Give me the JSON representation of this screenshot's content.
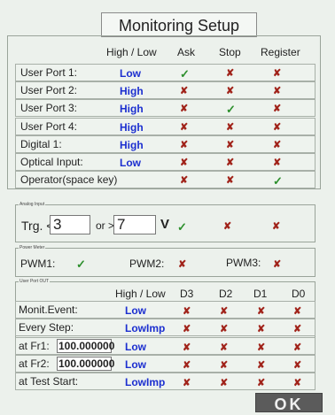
{
  "title": "Monitoring Setup",
  "monitor": {
    "headers": [
      "High / Low",
      "Ask",
      "Stop",
      "Register"
    ],
    "rows": [
      {
        "label": "User Port 1:",
        "level": "Low",
        "ask": "check",
        "stop": "x",
        "register": "x"
      },
      {
        "label": "User Port 2:",
        "level": "High",
        "ask": "x",
        "stop": "x",
        "register": "x"
      },
      {
        "label": "User Port 3:",
        "level": "High",
        "ask": "x",
        "stop": "check",
        "register": "x"
      },
      {
        "label": "User Port 4:",
        "level": "High",
        "ask": "x",
        "stop": "x",
        "register": "x"
      },
      {
        "label": "Digital 1:",
        "level": "High",
        "ask": "x",
        "stop": "x",
        "register": "x"
      },
      {
        "label": "Optical Input:",
        "level": "Low",
        "ask": "x",
        "stop": "x",
        "register": "x"
      },
      {
        "label": "Operator(space key)",
        "level": "",
        "ask": "x",
        "stop": "x",
        "register": "check"
      }
    ]
  },
  "analog": {
    "section_title": "Analog Input",
    "trg_label": "Trg. <",
    "low_value": "3",
    "or_label": "or >",
    "high_value": "7",
    "unit": "V",
    "ask": "check",
    "stop": "x",
    "register": "x"
  },
  "power": {
    "section_title": "Power Meter",
    "pwm1_label": "PWM1:",
    "pwm1": "check",
    "pwm2_label": "PWM2:",
    "pwm2": "x",
    "pwm3_label": "PWM3:",
    "pwm3": "x"
  },
  "userport_out": {
    "section_title": "User Port OUT",
    "headers": [
      "High / Low",
      "D3",
      "D2",
      "D1",
      "D0"
    ],
    "rows": [
      {
        "label": "Monit.Event:",
        "value": "",
        "level": "Low",
        "d": [
          "x",
          "x",
          "x",
          "x"
        ]
      },
      {
        "label": "Every Step:",
        "value": "",
        "level": "LowImp",
        "d": [
          "x",
          "x",
          "x",
          "x"
        ]
      },
      {
        "label": "at Fr1:",
        "value": "100.000000",
        "level": "Low",
        "d": [
          "x",
          "x",
          "x",
          "x"
        ]
      },
      {
        "label": "at Fr2:",
        "value": "100.000000",
        "level": "Low",
        "d": [
          "x",
          "x",
          "x",
          "x"
        ]
      },
      {
        "label": "at Test Start:",
        "value": "",
        "level": "LowImp",
        "d": [
          "x",
          "x",
          "x",
          "x"
        ]
      }
    ]
  },
  "ok_label": "OK",
  "symbols": {
    "check": "✓",
    "x": "✘"
  },
  "colors": {
    "accent_blue": "#1c2fd0",
    "x_red": "#a1241b",
    "check_green": "#2c8f2c",
    "ok_bg": "#5b5b5b"
  }
}
